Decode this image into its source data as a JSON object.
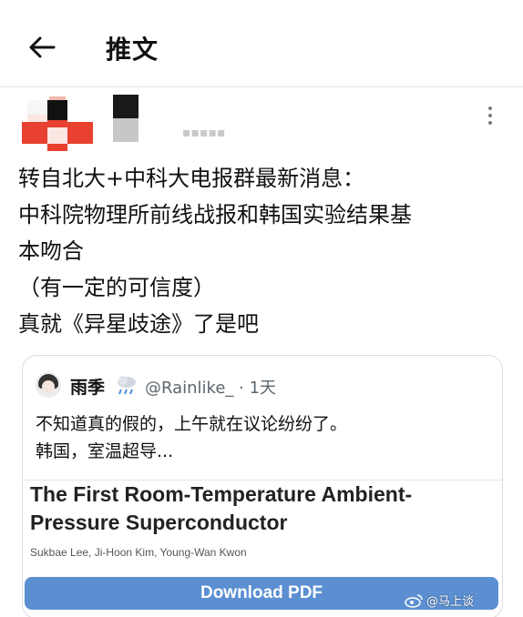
{
  "header": {
    "back_icon": "arrow-left-icon",
    "title": "推文"
  },
  "post": {
    "more_icon": "more-vertical-icon",
    "body_lines": [
      "转自北大+中科大电报群最新消息：",
      "中科院物理所前线战报和韩国实验结果基",
      "本吻合",
      "（有一定的可信度）",
      "真就《异星歧途》了是吧"
    ]
  },
  "quote": {
    "name": "雨季",
    "weather_icon": "cloud-rain-icon",
    "handle": "@Rainlike_ · 1天",
    "text_lines": [
      "不知道真的假的，上午就在议论纷纷了。",
      "韩国，室温超导..."
    ],
    "paper": {
      "title_lines": [
        "The First Room-Temperature Ambient-",
        "Pressure Superconductor"
      ],
      "authors": "Sukbae Lee, Ji-Hoon Kim, Young-Wan Kwon",
      "download_label": "Download PDF"
    }
  },
  "watermark": {
    "logo_icon": "weibo-logo-icon",
    "text": "@马上谈"
  },
  "colors": {
    "avatar_red": "#e8412f",
    "avatar_black": "#111111",
    "download_button": "#5b8fd1",
    "handle_gray": "#5b6670"
  }
}
